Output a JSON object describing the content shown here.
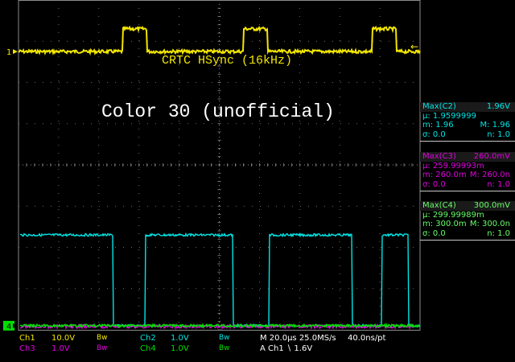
{
  "screen": {
    "trace_label": "CRTC HSync (16kHz)",
    "title_text": "Color 30 (unofficial)",
    "ch1_marker": "1",
    "ch4_marker": "4"
  },
  "colors": {
    "ch1": "#f2e600",
    "ch2": "#00e5e5",
    "ch3": "#e000e0",
    "ch4": "#00e000",
    "grid": "#8a8a8a",
    "measure_text_ch2": "#00e5e5",
    "measure_text_ch3": "#e000e0",
    "measure_text_ch4": "#66ff66"
  },
  "measurements": [
    {
      "name": "Max(C2)",
      "value": "1.96V",
      "mean_label": "μ:",
      "mean": "1.9599999",
      "min_label": "m:",
      "min": "1.96",
      "max_label": "M:",
      "max": "1.96",
      "sigma_label": "σ:",
      "sigma": "0.0",
      "n_label": "n:",
      "n": "1.0",
      "color": "#00e5e5"
    },
    {
      "name": "Max(C3)",
      "value": "260.0mV",
      "mean_label": "μ:",
      "mean": "259.99993m",
      "min_label": "m:",
      "min": "260.0m",
      "max_label": "M:",
      "max": "260.0n",
      "sigma_label": "σ:",
      "sigma": "0.0",
      "n_label": "n:",
      "n": "1.0",
      "color": "#e000e0"
    },
    {
      "name": "Max(C4)",
      "value": "300.0mV",
      "mean_label": "μ:",
      "mean": "299.99989m",
      "min_label": "m:",
      "min": "300.0m",
      "max_label": "M:",
      "max": "300.0n",
      "sigma_label": "σ:",
      "sigma": "0.0",
      "n_label": "n:",
      "n": "1.0",
      "color": "#66ff66"
    }
  ],
  "status_bar": {
    "ch1": {
      "name": "Ch1",
      "scale": "10.0V",
      "bw": "Bw"
    },
    "ch2": {
      "name": "Ch2",
      "scale": "1.0V",
      "bw": "Bw"
    },
    "ch3": {
      "name": "Ch3",
      "scale": "1.0V",
      "bw": "Bw"
    },
    "ch4": {
      "name": "Ch4",
      "scale": "1.0V",
      "bw": "Bw"
    },
    "timebase": "M 20.0μs 25.0MS/s",
    "sample_interval": "40.0ns/pt",
    "trigger": "A  Ch1  ∖  1.6V"
  },
  "waveforms": {
    "ch1_pulses_at_us": [
      [
        26,
        32
      ],
      [
        56,
        62
      ],
      [
        88,
        94
      ]
    ],
    "ch2_high_intervals_us": [
      [
        0,
        23.5
      ],
      [
        31.5,
        53.5
      ],
      [
        62.5,
        83
      ],
      [
        90.5,
        97
      ]
    ],
    "ch2_high_level_div": 5.7,
    "ch2_low_level_div": 7.9,
    "ch1_low_level_div": 1.25,
    "ch1_high_level_div": 0.7
  }
}
